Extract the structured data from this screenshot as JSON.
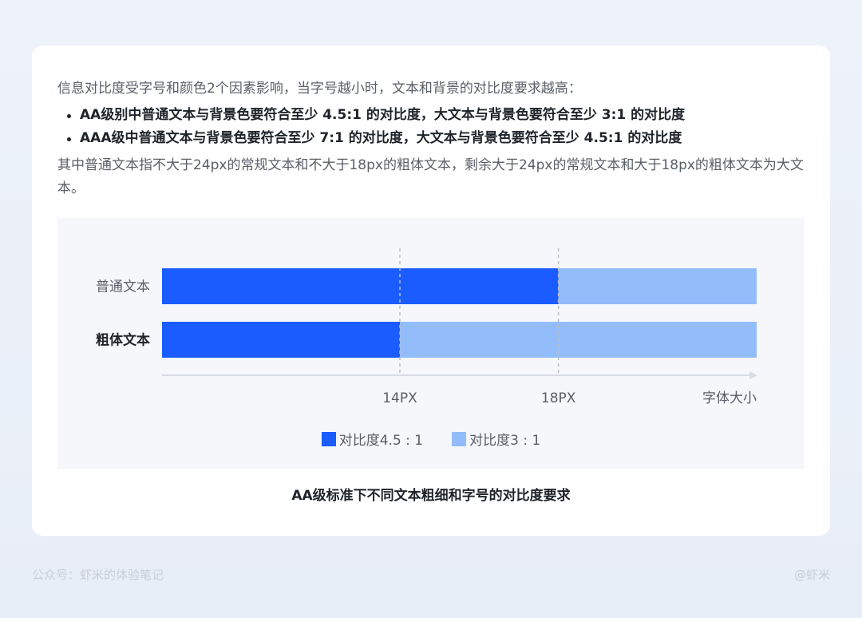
{
  "intro_text": "信息对比度受字号和颜色2个因素影响，当字号越小时，文本和背景的对比度要求越高：",
  "bullets": [
    "AA级别中普通文本与背景色要符合至少 4.5:1 的对比度，大文本与背景色要符合至少 3:1 的对比度",
    "AAA级中普通文本与背景色要符合至少 7:1 的对比度，大文本与背景色要符合至少 4.5:1 的对比度"
  ],
  "note_text": "其中普通文本指不大于24px的常规文本和不大于18px的粗体文本，剩余大于24px的常规文本和大于18px的粗体文本为大文本。",
  "caption": "AA级标准下不同文本粗细和字号的对比度要求",
  "footer": {
    "left": "公众号：虾米的体验笔记",
    "right": "@虾米"
  },
  "chart_data": {
    "type": "bar",
    "orientation": "horizontal-stacked",
    "categories": [
      "普通文本",
      "粗体文本"
    ],
    "category_bold": [
      false,
      true
    ],
    "thresholds": [
      {
        "label": "14PX",
        "value": 14
      },
      {
        "label": "18PX",
        "value": 18
      }
    ],
    "axis_label": "字体大小",
    "x_range": [
      8,
      23
    ],
    "series": [
      {
        "name": "对比度4.5 : 1",
        "color": "#1a5cff",
        "segments": [
          [
            8,
            18
          ],
          [
            8,
            14
          ]
        ]
      },
      {
        "name": "对比度3 : 1",
        "color": "#93bdfa",
        "segments": [
          [
            18,
            23
          ],
          [
            14,
            23
          ]
        ]
      }
    ],
    "grid": false,
    "legend_position": "bottom-center"
  }
}
